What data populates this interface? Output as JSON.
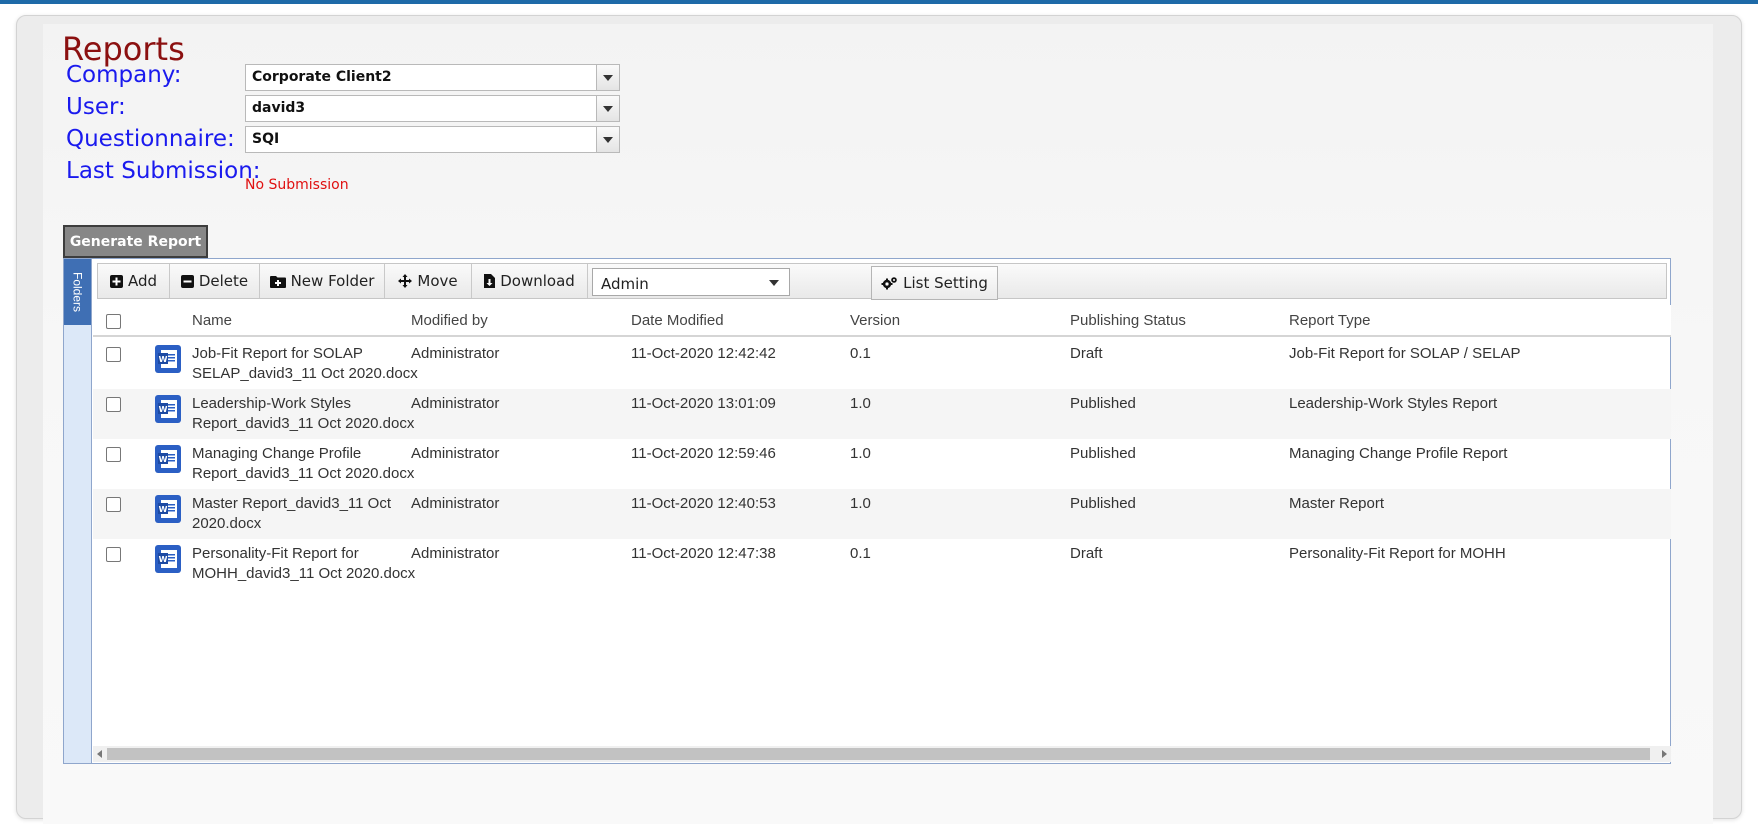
{
  "page": {
    "title": "Reports",
    "filters": {
      "company": {
        "label": "Company:",
        "value": "Corporate Client2"
      },
      "user": {
        "label": "User:",
        "value": "david3"
      },
      "questionnaire": {
        "label": "Questionnaire:",
        "value": "SQI"
      },
      "last_submission": {
        "label": "Last Submission:",
        "value": "No Submission"
      }
    },
    "generate_button": "Generate Report"
  },
  "library": {
    "folders_tab": "Folders",
    "toolbar": {
      "add": "Add",
      "delete": "Delete",
      "new_folder": "New Folder",
      "move": "Move",
      "download": "Download",
      "view_select": "Admin",
      "list_setting": "List Setting"
    },
    "columns": [
      "Name",
      "Modified by",
      "Date Modified",
      "Version",
      "Publishing Status",
      "Report Type"
    ],
    "rows": [
      {
        "name1": "Job-Fit Report for SOLAP",
        "name2": "SELAP_david3_11 Oct 2020.docx",
        "modified_by": "Administrator",
        "date": "11-Oct-2020 12:42:42",
        "version": "0.1",
        "status": "Draft",
        "type": "Job-Fit Report for SOLAP / SELAP"
      },
      {
        "name1": "Leadership-Work Styles",
        "name2": "Report_david3_11 Oct 2020.docx",
        "modified_by": "Administrator",
        "date": "11-Oct-2020 13:01:09",
        "version": "1.0",
        "status": "Published",
        "type": "Leadership-Work Styles Report"
      },
      {
        "name1": "Managing Change Profile",
        "name2": "Report_david3_11 Oct 2020.docx",
        "modified_by": "Administrator",
        "date": "11-Oct-2020 12:59:46",
        "version": "1.0",
        "status": "Published",
        "type": "Managing Change Profile Report"
      },
      {
        "name1": "Master Report_david3_11 Oct",
        "name2": "2020.docx",
        "modified_by": "Administrator",
        "date": "11-Oct-2020 12:40:53",
        "version": "1.0",
        "status": "Published",
        "type": "Master Report"
      },
      {
        "name1": "Personality-Fit Report for",
        "name2": "MOHH_david3_11 Oct 2020.docx",
        "modified_by": "Administrator",
        "date": "11-Oct-2020 12:47:38",
        "version": "0.1",
        "status": "Draft",
        "type": "Personality-Fit Report for MOHH"
      }
    ]
  },
  "colors": {
    "title": "#8b1010",
    "labels": "#1a1aee",
    "no_submission": "#e01010",
    "accent": "#1e6aa8",
    "word_icon": "#2b5fc4"
  }
}
